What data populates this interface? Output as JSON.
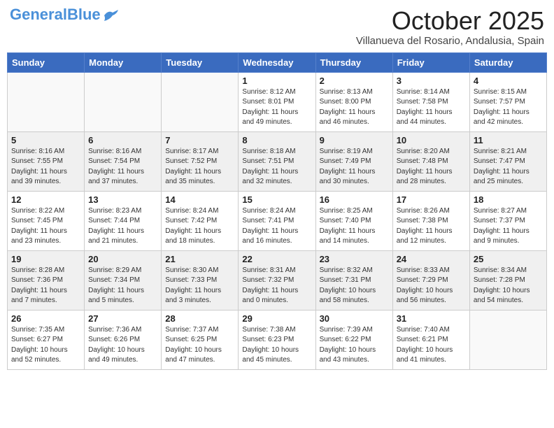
{
  "header": {
    "logo_general": "General",
    "logo_blue": "Blue",
    "month": "October 2025",
    "location": "Villanueva del Rosario, Andalusia, Spain"
  },
  "weekdays": [
    "Sunday",
    "Monday",
    "Tuesday",
    "Wednesday",
    "Thursday",
    "Friday",
    "Saturday"
  ],
  "weeks": [
    [
      {
        "day": "",
        "info": ""
      },
      {
        "day": "",
        "info": ""
      },
      {
        "day": "",
        "info": ""
      },
      {
        "day": "1",
        "info": "Sunrise: 8:12 AM\nSunset: 8:01 PM\nDaylight: 11 hours\nand 49 minutes."
      },
      {
        "day": "2",
        "info": "Sunrise: 8:13 AM\nSunset: 8:00 PM\nDaylight: 11 hours\nand 46 minutes."
      },
      {
        "day": "3",
        "info": "Sunrise: 8:14 AM\nSunset: 7:58 PM\nDaylight: 11 hours\nand 44 minutes."
      },
      {
        "day": "4",
        "info": "Sunrise: 8:15 AM\nSunset: 7:57 PM\nDaylight: 11 hours\nand 42 minutes."
      }
    ],
    [
      {
        "day": "5",
        "info": "Sunrise: 8:16 AM\nSunset: 7:55 PM\nDaylight: 11 hours\nand 39 minutes."
      },
      {
        "day": "6",
        "info": "Sunrise: 8:16 AM\nSunset: 7:54 PM\nDaylight: 11 hours\nand 37 minutes."
      },
      {
        "day": "7",
        "info": "Sunrise: 8:17 AM\nSunset: 7:52 PM\nDaylight: 11 hours\nand 35 minutes."
      },
      {
        "day": "8",
        "info": "Sunrise: 8:18 AM\nSunset: 7:51 PM\nDaylight: 11 hours\nand 32 minutes."
      },
      {
        "day": "9",
        "info": "Sunrise: 8:19 AM\nSunset: 7:49 PM\nDaylight: 11 hours\nand 30 minutes."
      },
      {
        "day": "10",
        "info": "Sunrise: 8:20 AM\nSunset: 7:48 PM\nDaylight: 11 hours\nand 28 minutes."
      },
      {
        "day": "11",
        "info": "Sunrise: 8:21 AM\nSunset: 7:47 PM\nDaylight: 11 hours\nand 25 minutes."
      }
    ],
    [
      {
        "day": "12",
        "info": "Sunrise: 8:22 AM\nSunset: 7:45 PM\nDaylight: 11 hours\nand 23 minutes."
      },
      {
        "day": "13",
        "info": "Sunrise: 8:23 AM\nSunset: 7:44 PM\nDaylight: 11 hours\nand 21 minutes."
      },
      {
        "day": "14",
        "info": "Sunrise: 8:24 AM\nSunset: 7:42 PM\nDaylight: 11 hours\nand 18 minutes."
      },
      {
        "day": "15",
        "info": "Sunrise: 8:24 AM\nSunset: 7:41 PM\nDaylight: 11 hours\nand 16 minutes."
      },
      {
        "day": "16",
        "info": "Sunrise: 8:25 AM\nSunset: 7:40 PM\nDaylight: 11 hours\nand 14 minutes."
      },
      {
        "day": "17",
        "info": "Sunrise: 8:26 AM\nSunset: 7:38 PM\nDaylight: 11 hours\nand 12 minutes."
      },
      {
        "day": "18",
        "info": "Sunrise: 8:27 AM\nSunset: 7:37 PM\nDaylight: 11 hours\nand 9 minutes."
      }
    ],
    [
      {
        "day": "19",
        "info": "Sunrise: 8:28 AM\nSunset: 7:36 PM\nDaylight: 11 hours\nand 7 minutes."
      },
      {
        "day": "20",
        "info": "Sunrise: 8:29 AM\nSunset: 7:34 PM\nDaylight: 11 hours\nand 5 minutes."
      },
      {
        "day": "21",
        "info": "Sunrise: 8:30 AM\nSunset: 7:33 PM\nDaylight: 11 hours\nand 3 minutes."
      },
      {
        "day": "22",
        "info": "Sunrise: 8:31 AM\nSunset: 7:32 PM\nDaylight: 11 hours\nand 0 minutes."
      },
      {
        "day": "23",
        "info": "Sunrise: 8:32 AM\nSunset: 7:31 PM\nDaylight: 10 hours\nand 58 minutes."
      },
      {
        "day": "24",
        "info": "Sunrise: 8:33 AM\nSunset: 7:29 PM\nDaylight: 10 hours\nand 56 minutes."
      },
      {
        "day": "25",
        "info": "Sunrise: 8:34 AM\nSunset: 7:28 PM\nDaylight: 10 hours\nand 54 minutes."
      }
    ],
    [
      {
        "day": "26",
        "info": "Sunrise: 7:35 AM\nSunset: 6:27 PM\nDaylight: 10 hours\nand 52 minutes."
      },
      {
        "day": "27",
        "info": "Sunrise: 7:36 AM\nSunset: 6:26 PM\nDaylight: 10 hours\nand 49 minutes."
      },
      {
        "day": "28",
        "info": "Sunrise: 7:37 AM\nSunset: 6:25 PM\nDaylight: 10 hours\nand 47 minutes."
      },
      {
        "day": "29",
        "info": "Sunrise: 7:38 AM\nSunset: 6:23 PM\nDaylight: 10 hours\nand 45 minutes."
      },
      {
        "day": "30",
        "info": "Sunrise: 7:39 AM\nSunset: 6:22 PM\nDaylight: 10 hours\nand 43 minutes."
      },
      {
        "day": "31",
        "info": "Sunrise: 7:40 AM\nSunset: 6:21 PM\nDaylight: 10 hours\nand 41 minutes."
      },
      {
        "day": "",
        "info": ""
      }
    ]
  ]
}
